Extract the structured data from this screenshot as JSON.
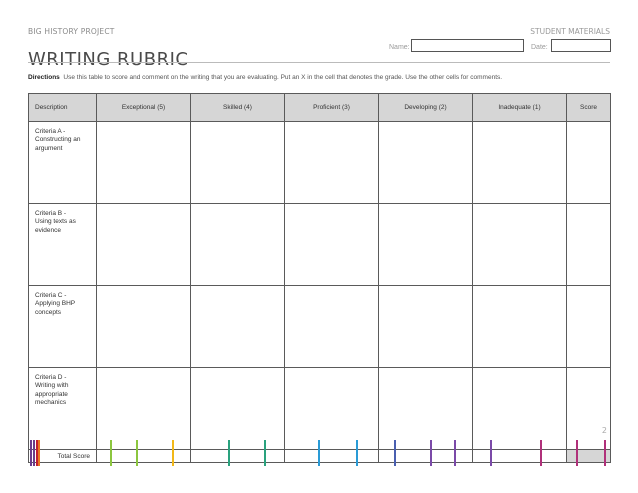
{
  "header": {
    "kicker": "BIG HISTORY PROJECT",
    "title": "WRITING RUBRIC",
    "materials": "STUDENT MATERIALS",
    "name_label": "Name:",
    "date_label": "Date:"
  },
  "directions": {
    "label": "Directions",
    "text": "Use this table to score and comment on the writing that you are evaluating. Put an X in the cell that denotes the grade. Use the other cells for comments."
  },
  "table": {
    "headers": [
      "Description",
      "Exceptional (5)",
      "Skilled (4)",
      "Proficient (3)",
      "Developing (2)",
      "Inadequate (1)",
      "Score"
    ],
    "criteria": [
      [
        "Criteria A -",
        "Constructing an",
        "argument"
      ],
      [
        "Criteria B -",
        "Using texts as",
        "evidence"
      ],
      [
        "Criteria C -",
        "Applying BHP",
        "concepts"
      ],
      [
        "Criteria D -",
        "Writing with",
        "appropriate",
        "mechanics"
      ]
    ],
    "total_label": "Total Score"
  },
  "footer": {
    "page_number": "2",
    "stripe_colors": [
      "#6b3a8a",
      "#c21f2f",
      "#e87722",
      "#f2b818",
      "#8cc63f",
      "#2aa27e",
      "#2a9bd6",
      "#4a5fb0",
      "#7b4aa8",
      "#b0307a"
    ]
  }
}
